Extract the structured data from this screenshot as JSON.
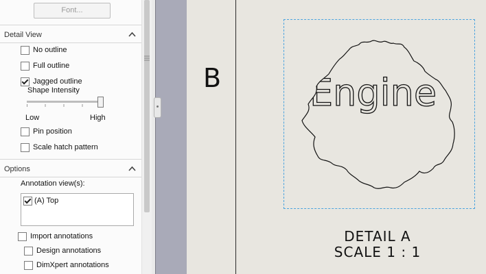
{
  "font_button": "Font...",
  "detail_view": {
    "title": "Detail View",
    "options": [
      {
        "label": "No outline",
        "checked": false
      },
      {
        "label": "Full outline",
        "checked": false
      },
      {
        "label": "Jagged outline",
        "checked": true
      }
    ],
    "shape_intensity": {
      "label": "Shape Intensity",
      "low": "Low",
      "high": "High",
      "value": 1.0
    },
    "pin_position": {
      "label": "Pin position",
      "checked": false
    },
    "scale_hatch": {
      "label": "Scale hatch pattern",
      "checked": false
    }
  },
  "options": {
    "title": "Options",
    "annotation_views_label": "Annotation view(s):",
    "annotation_views": [
      {
        "label": "(A) Top",
        "checked": true
      }
    ],
    "import_annotations": {
      "label": "Import annotations",
      "checked": false
    },
    "design_annotations": {
      "label": "Design annotations",
      "checked": false
    },
    "dimxpert_annotations": {
      "label": "DimXpert annotations",
      "checked": false
    }
  },
  "drawing": {
    "view_letter": "B",
    "detail_text": "Engine",
    "detail_label_line1": "DETAIL A",
    "detail_label_line2": "SCALE 1 : 1"
  }
}
